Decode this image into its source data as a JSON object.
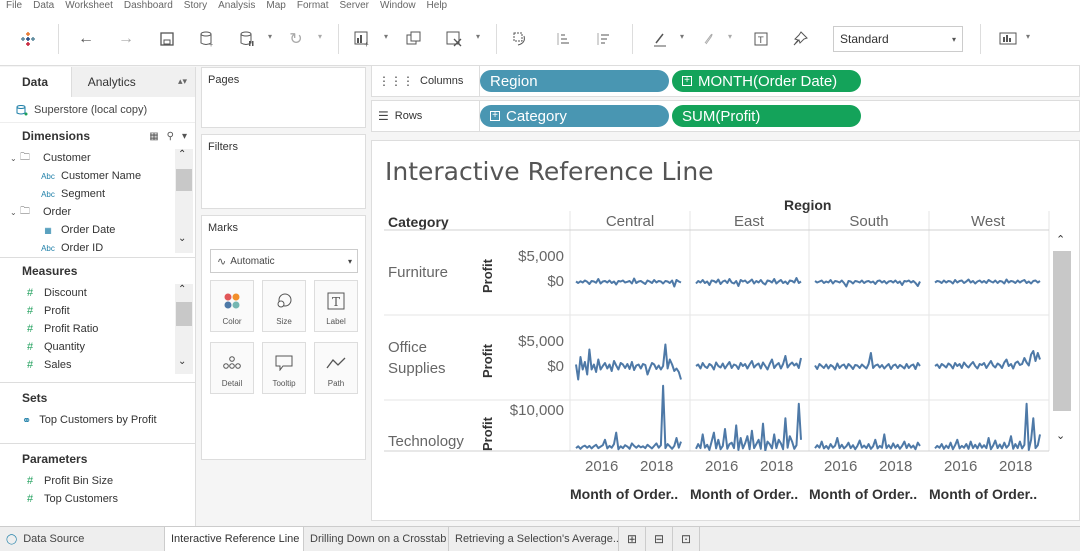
{
  "menu": [
    "File",
    "Data",
    "Worksheet",
    "Dashboard",
    "Story",
    "Analysis",
    "Map",
    "Format",
    "Server",
    "Window",
    "Help"
  ],
  "toolbar": {
    "standard_value": "Standard"
  },
  "left_pane": {
    "tab_data": "Data",
    "tab_analytics": "Analytics",
    "datasource": "Superstore (local copy)",
    "dimensions_header": "Dimensions",
    "dimensions": [
      {
        "label": "Customer",
        "kind": "folder"
      },
      {
        "label": "Customer Name",
        "kind": "abc"
      },
      {
        "label": "Segment",
        "kind": "abc"
      },
      {
        "label": "Order",
        "kind": "folder"
      },
      {
        "label": "Order Date",
        "kind": "date"
      },
      {
        "label": "Order ID",
        "kind": "abc"
      }
    ],
    "measures_header": "Measures",
    "measures": [
      "Discount",
      "Profit",
      "Profit Ratio",
      "Quantity",
      "Sales"
    ],
    "sets_header": "Sets",
    "sets": [
      "Top Customers by Profit"
    ],
    "parameters_header": "Parameters",
    "parameters": [
      "Profit Bin Size",
      "Top Customers"
    ]
  },
  "cards": {
    "pages": "Pages",
    "filters": "Filters",
    "marks": "Marks",
    "marks_type": "Automatic",
    "mark_buttons": [
      "Color",
      "Size",
      "Label",
      "Detail",
      "Tooltip",
      "Path"
    ]
  },
  "shelves": {
    "columns_label": "Columns",
    "rows_label": "Rows",
    "columns": [
      "Region",
      "MONTH(Order Date)"
    ],
    "rows": [
      "Category",
      "SUM(Profit)"
    ]
  },
  "viz": {
    "title": "Interactive Reference Line",
    "region_header": "Region",
    "category_header": "Category",
    "regions": [
      "Central",
      "East",
      "South",
      "West"
    ],
    "categories": [
      "Furniture",
      "Office Supplies",
      "Technology"
    ],
    "profit_axis_label": "Profit",
    "y_ticks": {
      "furniture": [
        "$5,000",
        "$0"
      ],
      "office": [
        "$5,000",
        "$0"
      ],
      "technology": [
        "$10,000"
      ]
    },
    "years": [
      "2016",
      "2018"
    ],
    "x_axis_label": "Month of Order.."
  },
  "chart_data": {
    "type": "line",
    "title": "Interactive Reference Line",
    "xlabel": "Month of Order Date",
    "ylabel": "Profit",
    "line_color": "#4e79a7",
    "panels": [
      {
        "category": "Furniture",
        "region": "Central",
        "values": [
          100,
          -200,
          150,
          -100,
          300,
          50,
          -400,
          200,
          100,
          -150,
          600,
          -300,
          100,
          200,
          -100,
          300,
          -200,
          100,
          -500,
          200,
          100,
          300,
          -100,
          50,
          200,
          -300,
          700,
          -200,
          100,
          200,
          -100,
          -400,
          300,
          100,
          -200,
          400,
          -100,
          200,
          100,
          -300,
          200,
          100,
          -200,
          300,
          -900,
          400,
          100,
          -100
        ]
      },
      {
        "category": "Furniture",
        "region": "East",
        "values": [
          -300,
          200,
          -100,
          400,
          -200,
          100,
          -600,
          300,
          200,
          -100,
          500,
          -400,
          100,
          300,
          -200,
          600,
          -100,
          -300,
          200,
          -800,
          400,
          100,
          300,
          -200,
          100,
          500,
          -300,
          200,
          -100,
          400,
          -200,
          -500,
          300,
          200,
          -100,
          600,
          -300,
          100,
          400,
          -200,
          100,
          -400,
          300,
          200,
          -100,
          800,
          -200,
          100
        ]
      },
      {
        "category": "Furniture",
        "region": "South",
        "values": [
          200,
          -100,
          100,
          300,
          -200,
          100,
          -100,
          400,
          -300,
          200,
          100,
          -100,
          300,
          -200,
          -900,
          200,
          100,
          -300,
          200,
          100,
          -100,
          300,
          -200,
          100,
          200,
          -100,
          100,
          -400,
          200,
          300,
          -100,
          200,
          -300,
          100,
          200,
          -100,
          300,
          -200,
          100,
          -600,
          200,
          100,
          300,
          -100,
          200,
          -200,
          -800,
          100
        ]
      },
      {
        "category": "Furniture",
        "region": "West",
        "values": [
          -100,
          200,
          100,
          -200,
          300,
          -100,
          200,
          100,
          -300,
          400,
          -100,
          200,
          300,
          -200,
          100,
          500,
          -100,
          200,
          -300,
          100,
          300,
          -100,
          200,
          -200,
          400,
          100,
          -100,
          300,
          -200,
          200,
          100,
          -300,
          500,
          -100,
          200,
          100,
          -200,
          300,
          -100,
          200,
          400,
          -200,
          100,
          -300,
          200,
          300,
          -100,
          200
        ]
      },
      {
        "category": "Office Supplies",
        "region": "Central",
        "values": [
          500,
          -2500,
          2000,
          -500,
          1000,
          -1500,
          3500,
          -500,
          500,
          -1000,
          1500,
          -500,
          200,
          800,
          -300,
          500,
          -800,
          1200,
          300,
          -500,
          800,
          500,
          -200,
          600,
          -400,
          1000,
          -600,
          300,
          500,
          -300,
          600,
          400,
          -1500,
          -300,
          800,
          500,
          -400,
          300,
          -500,
          200,
          4500,
          -300,
          1500,
          500,
          -800,
          -300,
          -1000,
          -2500
        ]
      },
      {
        "category": "Office Supplies",
        "region": "East",
        "values": [
          200,
          500,
          -300,
          800,
          100,
          -200,
          600,
          300,
          -500,
          900,
          200,
          -100,
          700,
          -300,
          400,
          1000,
          -200,
          500,
          300,
          -400,
          800,
          200,
          600,
          -300,
          500,
          1200,
          -100,
          400,
          700,
          -300,
          900,
          200,
          -500,
          600,
          1500,
          -200,
          400,
          800,
          -300,
          600,
          2200,
          -100,
          500,
          900,
          300,
          700,
          -200,
          1800
        ]
      },
      {
        "category": "Office Supplies",
        "region": "South",
        "values": [
          300,
          -400,
          600,
          200,
          -200,
          500,
          -300,
          400,
          100,
          -500,
          700,
          -200,
          300,
          500,
          -300,
          600,
          200,
          -400,
          400,
          300,
          -200,
          500,
          100,
          -300,
          600,
          2800,
          -200,
          300,
          500,
          -100,
          400,
          -300,
          200,
          600,
          -400,
          300,
          500,
          -200,
          400,
          100,
          -300,
          600,
          -200,
          300,
          500,
          -400,
          800,
          200
        ]
      },
      {
        "category": "Office Supplies",
        "region": "West",
        "values": [
          200,
          500,
          -200,
          600,
          300,
          -100,
          700,
          400,
          -300,
          800,
          200,
          600,
          -200,
          900,
          300,
          -100,
          500,
          1000,
          200,
          -300,
          600,
          400,
          800,
          -200,
          500,
          1200,
          300,
          -100,
          700,
          400,
          -200,
          900,
          1500,
          200,
          600,
          -300,
          800,
          1100,
          400,
          600,
          1800,
          900,
          300,
          2500,
          3200,
          1200,
          2800,
          1500
        ]
      },
      {
        "category": "Technology",
        "region": "Central",
        "values": [
          -300,
          200,
          -500,
          100,
          400,
          -200,
          300,
          -400,
          200,
          600,
          -300,
          100,
          500,
          2000,
          -400,
          300,
          -200,
          800,
          4000,
          -600,
          200,
          -300,
          500,
          100,
          -500,
          1000,
          300,
          -200,
          400,
          -100,
          200,
          -300,
          600,
          100,
          -400,
          300,
          1000,
          -200,
          500,
          17000,
          -300,
          800,
          200,
          -500,
          300,
          2500,
          -200,
          1500
        ]
      },
      {
        "category": "Technology",
        "region": "East",
        "values": [
          -500,
          800,
          -300,
          3500,
          -200,
          600,
          -800,
          1500,
          4000,
          -400,
          2000,
          -600,
          300,
          5000,
          -500,
          800,
          1200,
          -300,
          6000,
          -800,
          2500,
          -400,
          1000,
          3000,
          -600,
          4500,
          -300,
          800,
          2000,
          -500,
          6500,
          -1000,
          1500,
          800,
          -400,
          3500,
          -300,
          2000,
          1000,
          -600,
          8000,
          -200,
          3000,
          1500,
          -500,
          500,
          12000,
          2000
        ]
      },
      {
        "category": "Technology",
        "region": "South",
        "values": [
          -300,
          500,
          -200,
          1500,
          -400,
          300,
          -500,
          800,
          -200,
          400,
          2500,
          -300,
          600,
          -400,
          200,
          1200,
          -300,
          500,
          -600,
          300,
          1800,
          -200,
          400,
          -300,
          800,
          -500,
          200,
          2000,
          -400,
          300,
          -200,
          3500,
          -300,
          500,
          -400,
          1000,
          -200,
          600,
          -500,
          300,
          1500,
          -300,
          800,
          -200,
          400,
          -600,
          1200,
          300
        ]
      },
      {
        "category": "Technology",
        "region": "West",
        "values": [
          -400,
          300,
          -200,
          800,
          -500,
          400,
          -300,
          1200,
          -600,
          500,
          2000,
          -400,
          300,
          -200,
          800,
          -500,
          1500,
          -300,
          600,
          -400,
          1000,
          -200,
          500,
          -300,
          2500,
          -600,
          400,
          1800,
          -300,
          700,
          -400,
          1200,
          -200,
          500,
          3000,
          -500,
          800,
          -300,
          1500,
          -400,
          600,
          12000,
          -800,
          2000,
          8000,
          -300,
          500,
          3500
        ]
      }
    ]
  },
  "bottom_tabs": {
    "data_source": "Data Source",
    "sheets": [
      "Interactive Reference Line",
      "Drilling Down on a Crosstab",
      "Retrieving a Selection's Average..."
    ]
  }
}
